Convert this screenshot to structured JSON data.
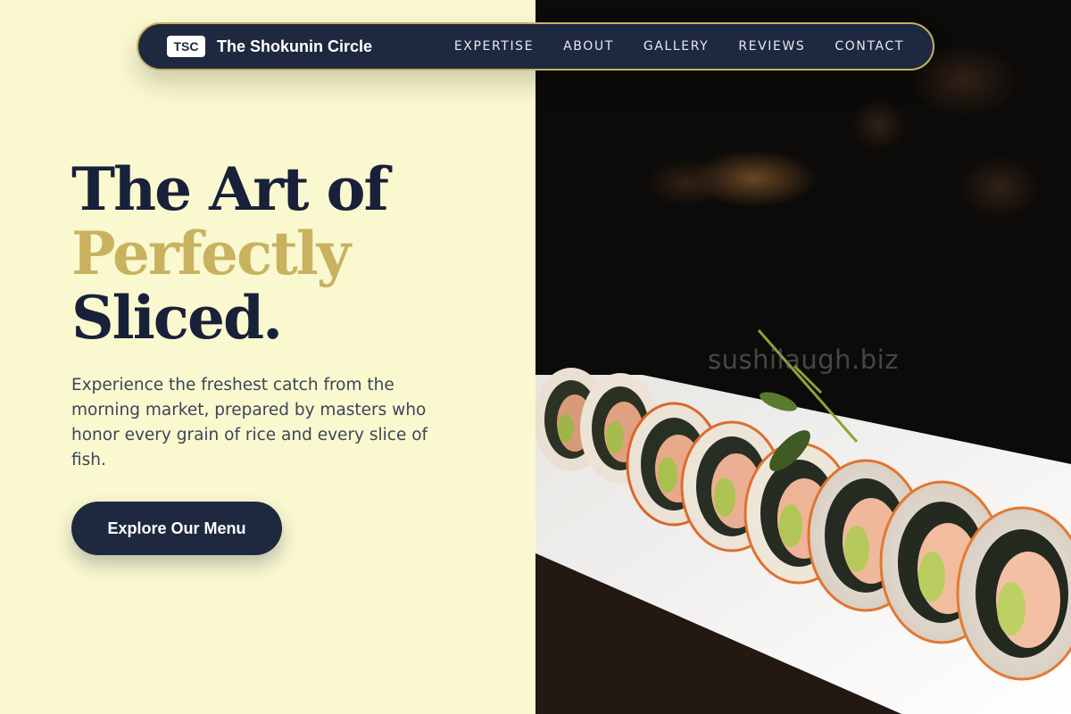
{
  "brand": {
    "badge": "TSC",
    "name": "The Shokunin Circle"
  },
  "nav": {
    "links": [
      "EXPERTISE",
      "ABOUT",
      "GALLERY",
      "REVIEWS",
      "CONTACT"
    ]
  },
  "hero": {
    "title_line1": "The Art of",
    "title_line2": "Perfectly",
    "title_line3": "Sliced.",
    "description": "Experience the freshest catch from the morning market, prepared by masters who honor every grain of rice and every slice of fish.",
    "cta_label": "Explore Our Menu"
  },
  "watermark": "sushilaugh.biz",
  "colors": {
    "background": "#f9f8cf",
    "navy": "#1e2940",
    "gold_accent": "#c9b25f",
    "nav_border": "#c4b266"
  }
}
